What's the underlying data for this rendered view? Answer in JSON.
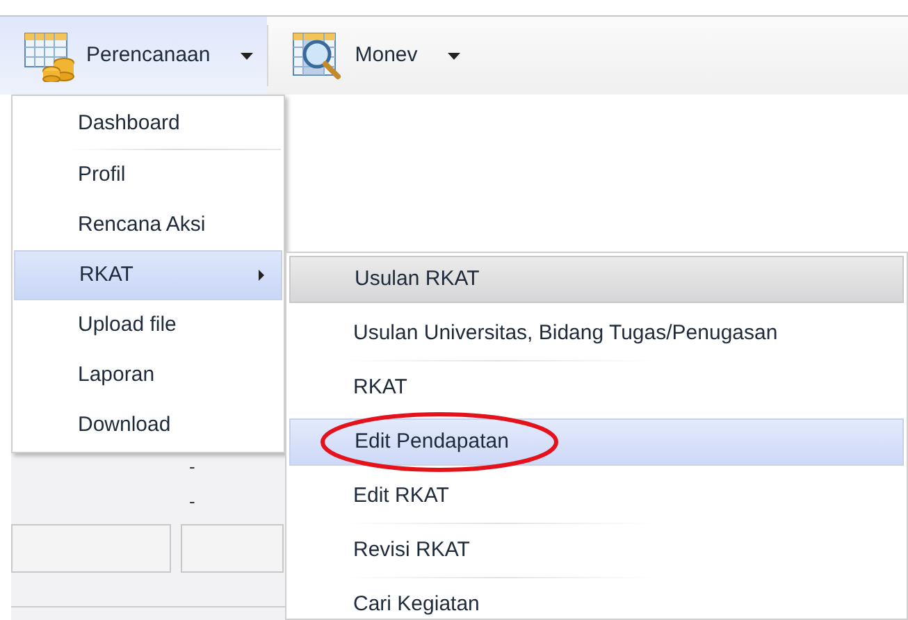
{
  "toolbar": [
    {
      "label": "Perencanaan",
      "selected": true
    },
    {
      "label": "Monev",
      "selected": false
    }
  ],
  "menu": [
    {
      "label": "Dashboard",
      "selected": false,
      "separator_after": true
    },
    {
      "label": "Profil",
      "selected": false
    },
    {
      "label": "Rencana Aksi",
      "selected": false
    },
    {
      "label": "RKAT",
      "selected": true,
      "has_submenu": true
    },
    {
      "label": "Upload file",
      "selected": false
    },
    {
      "label": "Laporan",
      "selected": false
    },
    {
      "label": "Download",
      "selected": false
    }
  ],
  "submenu": [
    {
      "label": "Usulan RKAT",
      "selected": false,
      "hovered": true
    },
    {
      "label": "Usulan Universitas, Bidang Tugas/Penugasan",
      "selected": false,
      "separator_after": true
    },
    {
      "label": "RKAT",
      "selected": false
    },
    {
      "label": "Edit Pendapatan",
      "selected": true,
      "circled": true
    },
    {
      "label": "Edit RKAT",
      "selected": false,
      "separator_after": true
    },
    {
      "label": "Revisi RKAT",
      "selected": false,
      "separator_after": true
    },
    {
      "label": "Cari Kegiatan",
      "selected": false
    }
  ],
  "background_form": {
    "values": [
      "-",
      "-"
    ]
  }
}
